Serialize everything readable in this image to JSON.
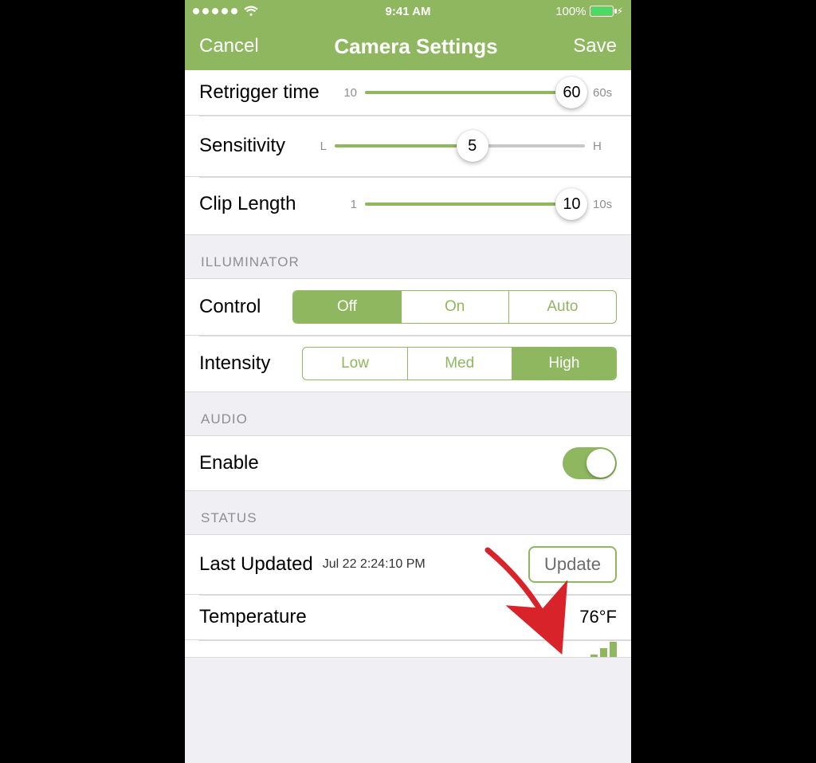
{
  "colors": {
    "accent": "#8eb760",
    "battery_fill": "#4cd964",
    "arrow": "#d8232a"
  },
  "statusbar": {
    "time": "9:41 AM",
    "battery_percent": "100%"
  },
  "navbar": {
    "cancel": "Cancel",
    "title": "Camera Settings",
    "save": "Save"
  },
  "sliders": {
    "retrigger": {
      "label": "Retrigger time",
      "min_label": "10",
      "max_label": "60s",
      "value": "60",
      "fill_pct": 100,
      "thumb_pct": 100
    },
    "sensitivity": {
      "label": "Sensitivity",
      "min_label": "L",
      "max_label": "H",
      "value": "5",
      "fill_pct": 55,
      "thumb_pct": 55
    },
    "clip": {
      "label": "Clip Length",
      "min_label": "1",
      "max_label": "10s",
      "value": "10",
      "fill_pct": 100,
      "thumb_pct": 100
    }
  },
  "sections": {
    "illuminator": "ILLUMINATOR",
    "audio": "AUDIO",
    "status": "STATUS"
  },
  "illuminator": {
    "control_label": "Control",
    "control_options": {
      "off": "Off",
      "on": "On",
      "auto": "Auto"
    },
    "control_selected": "Off",
    "intensity_label": "Intensity",
    "intensity_options": {
      "low": "Low",
      "med": "Med",
      "high": "High"
    },
    "intensity_selected": "High"
  },
  "audio": {
    "enable_label": "Enable",
    "enabled": true
  },
  "status": {
    "last_updated_label": "Last Updated",
    "last_updated_value": "Jul 22 2:24:10 PM",
    "update_button": "Update",
    "temperature_label": "Temperature",
    "temperature_value": "76°F"
  }
}
